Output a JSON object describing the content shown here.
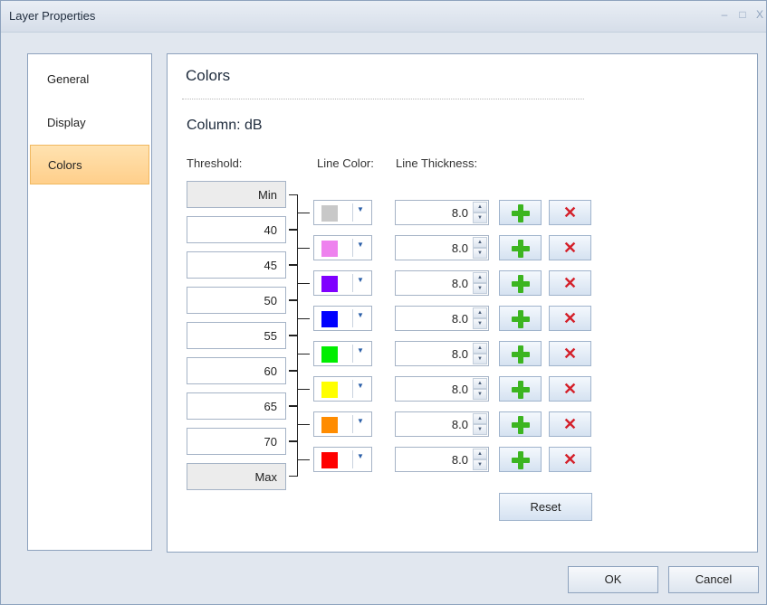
{
  "window": {
    "title": "Layer Properties",
    "minimize": "–",
    "maximize": "□",
    "close": "X"
  },
  "sidebar": {
    "items": [
      {
        "label": "General"
      },
      {
        "label": "Display"
      },
      {
        "label": "Colors",
        "active": true
      }
    ]
  },
  "main": {
    "title": "Colors",
    "column_label": "Column: dB",
    "headers": {
      "threshold": "Threshold:",
      "line_color": "Line Color:",
      "line_thickness": "Line Thickness:"
    },
    "thresholds": [
      "Min",
      "40",
      "45",
      "50",
      "55",
      "60",
      "65",
      "70",
      "Max"
    ],
    "rows": [
      {
        "color": "#c8c8c8",
        "thickness": "8.0"
      },
      {
        "color": "#ee82ee",
        "thickness": "8.0"
      },
      {
        "color": "#7f00ff",
        "thickness": "8.0"
      },
      {
        "color": "#0000ff",
        "thickness": "8.0"
      },
      {
        "color": "#00ee00",
        "thickness": "8.0"
      },
      {
        "color": "#ffff00",
        "thickness": "8.0"
      },
      {
        "color": "#ff8c00",
        "thickness": "8.0"
      },
      {
        "color": "#ff0000",
        "thickness": "8.0"
      }
    ],
    "reset_label": "Reset"
  },
  "footer": {
    "ok_label": "OK",
    "cancel_label": "Cancel"
  },
  "icons": {
    "add": "plus-icon",
    "delete": "delete-icon",
    "dropdown": "chevron-down-icon"
  }
}
